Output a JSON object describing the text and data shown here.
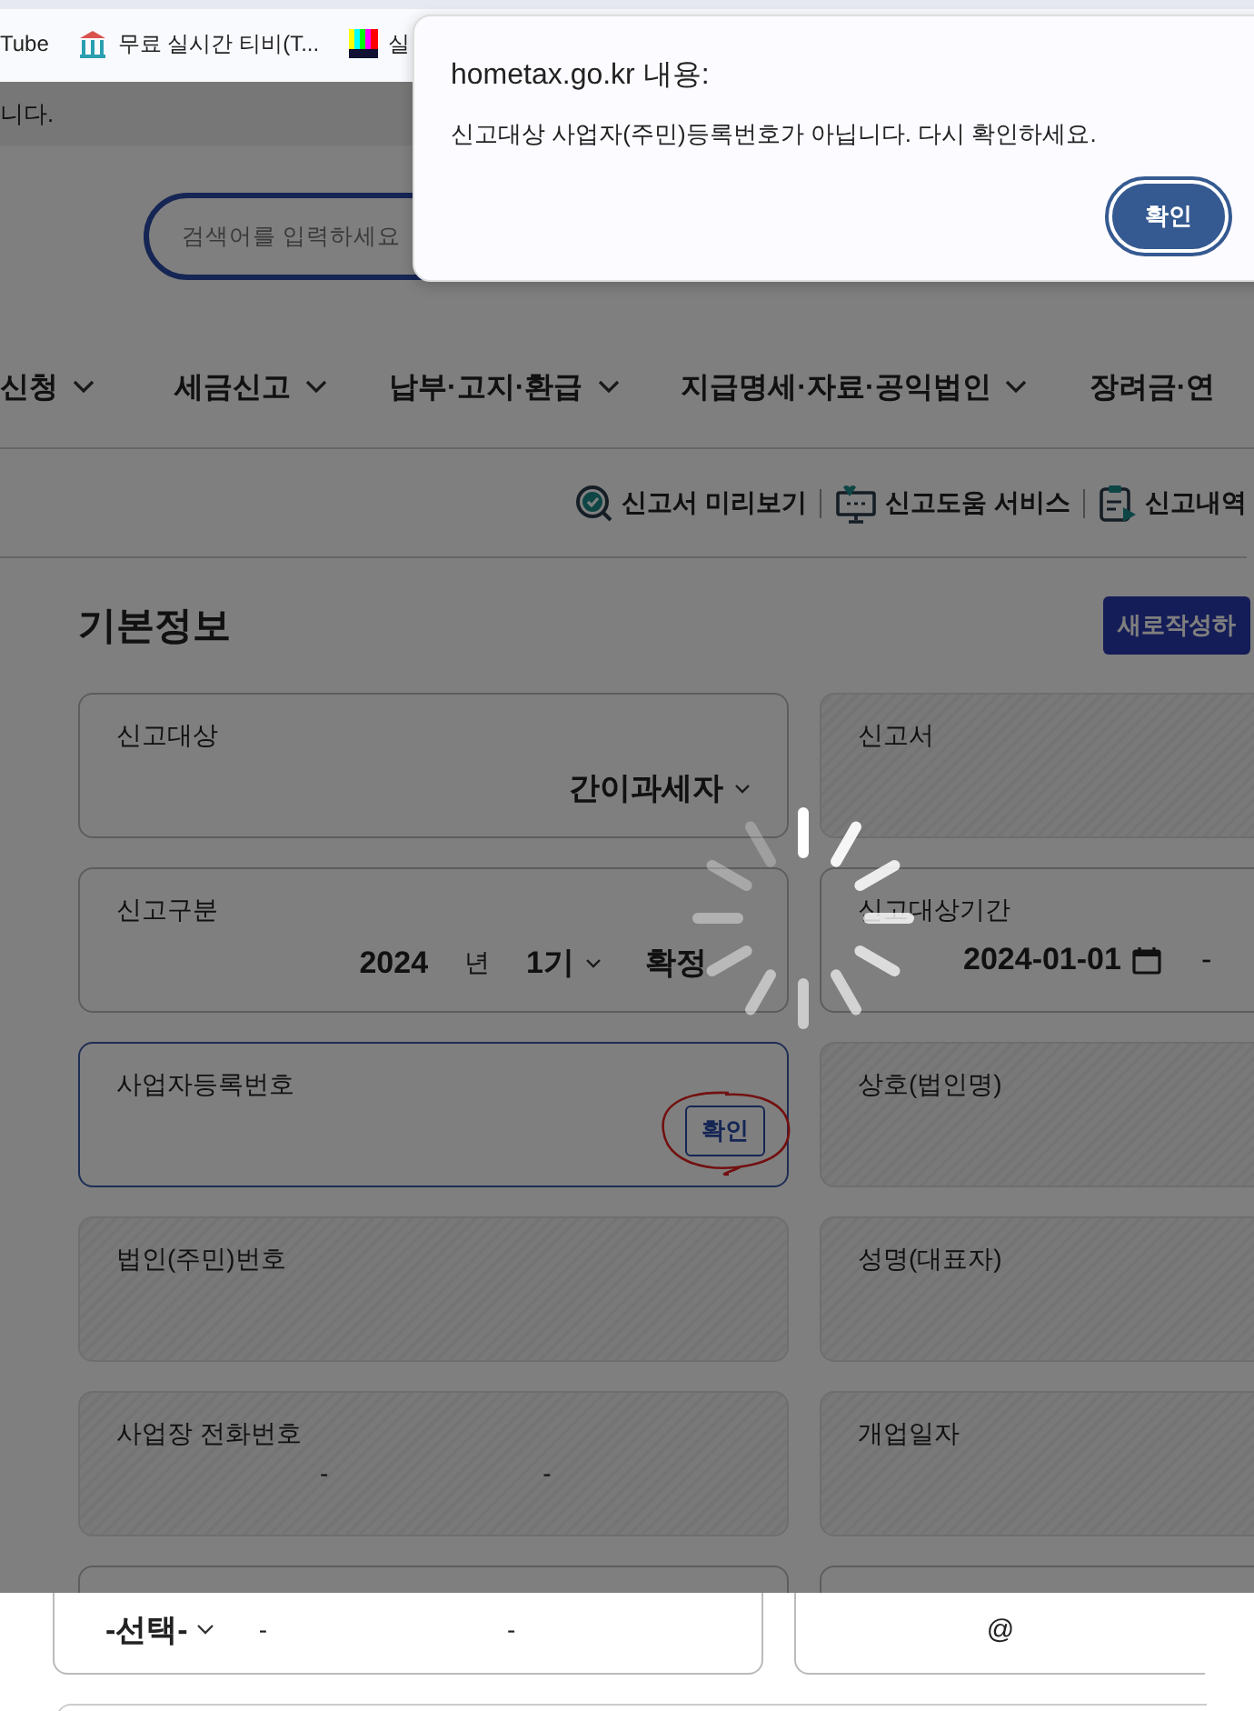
{
  "bookmarks": [
    {
      "label": "Tube"
    },
    {
      "label": "무료 실시간 티비(T..."
    },
    {
      "label": "실"
    }
  ],
  "notice": "니다.",
  "search": {
    "placeholder": "검색어를 입력하세요"
  },
  "nav": [
    "신청",
    "세금신고",
    "납부·고지·환급",
    "지급명세·자료·공익법인",
    "장려금·연"
  ],
  "tools": [
    {
      "label": "신고서 미리보기"
    },
    {
      "label": "신고도움 서비스"
    },
    {
      "label": "신고내역"
    }
  ],
  "section": {
    "title": "기본정보",
    "button": "새로작성하"
  },
  "cards": [
    {
      "label": "신고대상",
      "kind": "select",
      "value": "간이과세자",
      "disabled": false,
      "focused": false
    },
    {
      "label": "신고서",
      "kind": "empty",
      "disabled": true,
      "focused": false
    },
    {
      "label": "신고구분",
      "kind": "period",
      "year": "2024",
      "year_unit": "년",
      "term": "1기",
      "type": "확정",
      "disabled": false,
      "focused": false
    },
    {
      "label": "신고대상기간",
      "kind": "date",
      "value": "2024-01-01",
      "separator": "-",
      "disabled": false,
      "focused": false
    },
    {
      "label": "사업자등록번호",
      "kind": "button",
      "button": "확인",
      "annotated": true,
      "disabled": false,
      "focused": true
    },
    {
      "label": "상호(법인명)",
      "kind": "empty",
      "disabled": true,
      "focused": false
    },
    {
      "label": "법인(주민)번호",
      "kind": "empty",
      "disabled": true,
      "focused": false
    },
    {
      "label": "성명(대표자)",
      "kind": "empty",
      "disabled": true,
      "focused": false
    },
    {
      "label": "사업장 전화번호",
      "kind": "phone",
      "separators": [
        "-",
        "-"
      ],
      "disabled": true,
      "focused": false
    },
    {
      "label": "개업일자",
      "kind": "empty",
      "disabled": true,
      "focused": false
    }
  ],
  "lower_strip": {
    "phone_prefix": "-선택-",
    "separators": [
      "-",
      "-"
    ],
    "email_at": "@"
  },
  "dialog": {
    "title": "hometax.go.kr 내용:",
    "message": "신고대상 사업자(주민)등록번호가 아닙니다. 다시 확인하세요.",
    "button": "확인"
  },
  "loading": true
}
